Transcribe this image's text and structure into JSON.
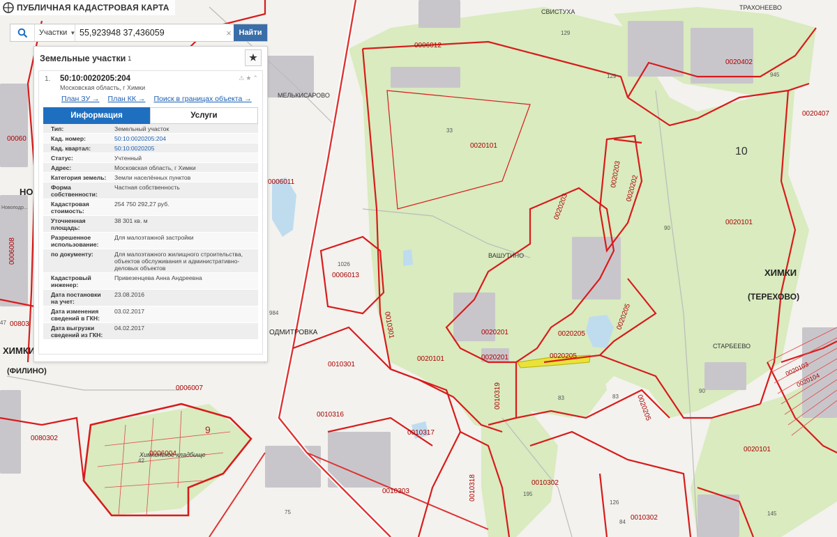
{
  "app": {
    "title": "ПУБЛИЧНАЯ КАДАСТРОВАЯ КАРТА"
  },
  "search": {
    "type_label": "Участки",
    "value": "55,923948 37,436059",
    "button_label": "Найти",
    "clear_label": "×"
  },
  "panel": {
    "title": "Земельные участки",
    "count_sup": "1",
    "favorite_icon": "star-icon"
  },
  "card": {
    "index": "1.",
    "cad_number": "50:10:0020205:204",
    "address": "Московская область, г Химки",
    "links": {
      "plan_zu": "План ЗУ →",
      "plan_kk": "План КК →",
      "search_in_bounds": "Поиск в границах объекта →"
    },
    "tabs": {
      "info": "Информация",
      "services": "Услуги"
    },
    "rows": [
      {
        "k": "Тип:",
        "v": "Земельный участок"
      },
      {
        "k": "Кад. номер:",
        "v": "50:10:0020205:204"
      },
      {
        "k": "Кад. квартал:",
        "v": "50:10:0020205"
      },
      {
        "k": "Статус:",
        "v": "Учтенный"
      },
      {
        "k": "Адрес:",
        "v": "Московская область, г Химки"
      },
      {
        "k": "Категория земель:",
        "v": "Земли населённых пунктов"
      },
      {
        "k": "Форма собственности:",
        "v": "Частная собственность"
      },
      {
        "k": "Кадастровая стоимость:",
        "v": "254 750 292,27 руб."
      },
      {
        "k": "Уточненная площадь:",
        "v": "38 301 кв. м"
      },
      {
        "k": "Разрешенное использование:",
        "v": "Для малоэтажной застройки"
      },
      {
        "k": "по документу:",
        "v": "Для малоэтажного жилищного строительства, объектов обслуживания и административно-деловых объектов"
      },
      {
        "k": "Кадастровый инженер:",
        "v": "Привезенцева Анна Андреевна"
      },
      {
        "k": "Дата постановки на учет:",
        "v": "23.08.2016"
      },
      {
        "k": "Дата изменения сведений в ГКН:",
        "v": "03.02.2017"
      },
      {
        "k": "Дата выгрузки сведений из ГКН:",
        "v": "04.02.2017"
      }
    ]
  },
  "map_labels": {
    "svistukha": "СВИСТУХА",
    "trakhoneevo": "ТРАХОНЕЕВО",
    "melkisarovo": "МЕЛЬКИСАРОВО",
    "vashutino": "ВАШУТИНО",
    "khimki": "ХИМКИ",
    "terekhovo": "(ТЕРЕХОВО)",
    "starbeevo": "СТАРБЕЕВО",
    "mitrovka": "ОДМИТРОВКА",
    "khimki_left": "ХИМКИ",
    "filino": "(ФИЛИНО)",
    "cemetery": "Химкинское кладбище",
    "no": "НО",
    "q0006012": "0006012",
    "q0020402": "0020402",
    "q0020407": "0020407",
    "q0020101_top": "0020101",
    "q0020101_right": "0020101",
    "q0020101_bottom": "0020101",
    "q0020101_br": "0020101",
    "q0020203a": "0020203",
    "q0020203b": "0020203",
    "q0020202": "0020202",
    "q0020201a": "0020201",
    "q0020201b": "0020201",
    "q0020205a": "0020205",
    "q0020205b": "0020205",
    "q0020205c": "0020205",
    "q0020205d": "0020205",
    "q0006011": "0006011",
    "q0006013": "0006013",
    "q0010301a": "0010301",
    "q0010301b": "0010301",
    "q0010316": "0010316",
    "q0010317": "0010317",
    "q0010319": "0010319",
    "q0010318": "0010318",
    "q0010302a": "0010302",
    "q0010302b": "0010302",
    "q0010303": "0010303",
    "q0006007": "0006007",
    "q0006004": "0006004",
    "q0080302": "0080302",
    "q0020103": "0020103",
    "q0020104": "0020104",
    "q0006008": "0006008",
    "q0080": "00803",
    "q0060": "00060",
    "n10": "10",
    "n9": "9",
    "n33": "33",
    "n90a": "90",
    "n90b": "90",
    "n129a": "129",
    "n129b": "129",
    "n945": "945",
    "n1026": "1026",
    "n83a": "83",
    "n83b": "83",
    "n42": "42",
    "n75": "75",
    "n126": "126",
    "n195": "195",
    "n145": "145",
    "n47": "47",
    "n984": "984",
    "n84": "84",
    "novopod": "Новоподр..."
  }
}
